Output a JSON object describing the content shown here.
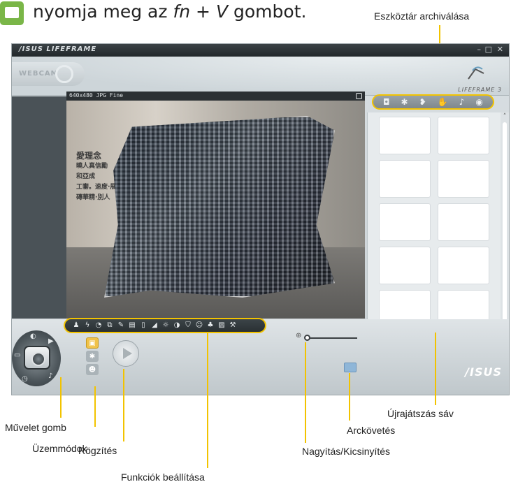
{
  "instruction": {
    "text_before": "nyomja meg az ",
    "key1": "fn",
    "plus": " + ",
    "key2": "V",
    "text_after": " gombot."
  },
  "callouts": {
    "toolbar_archive": "Eszköztár archiválása",
    "action_button": "Művelet gomb",
    "modes": "Üzemmódok",
    "record": "Rögzítés",
    "function_settings": "Funkciók beállítása",
    "replay_bar": "Újrajátszás sáv",
    "face_tracking": "Arckövetés",
    "zoom": "Nagyítás/Kicsinyítés"
  },
  "app": {
    "brand": "/ISUS LIFEFRAME",
    "window_controls": [
      "–",
      "□",
      "✕"
    ],
    "header_mode": "WEBCAM",
    "logo_text": "LIFEFRAME",
    "logo_version": "3",
    "preview_resolution": "640x480 JPG Fine",
    "bottom_logo": "/ISUS",
    "sign_lines": [
      "愛理念",
      "曉人真信勵",
      "和亞成",
      "工審。速度·展",
      "磚華精·別人"
    ]
  },
  "icons": {
    "toolbar": [
      "camera-icon",
      "settings-icon",
      "face-icon",
      "hand-icon",
      "microphone-icon",
      "eye-icon"
    ],
    "functions": [
      "person-icon",
      "flash-icon",
      "timer-icon",
      "burst-icon",
      "pencil-icon",
      "frame-icon",
      "frame-small-icon",
      "triangle-icon",
      "brightness-icon",
      "contrast-icon",
      "shield-icon",
      "face-detect-icon",
      "group-icon",
      "image-icon",
      "wrench-icon"
    ]
  },
  "colors": {
    "highlight": "#f2c300",
    "mode_active": "#f0c24a"
  }
}
